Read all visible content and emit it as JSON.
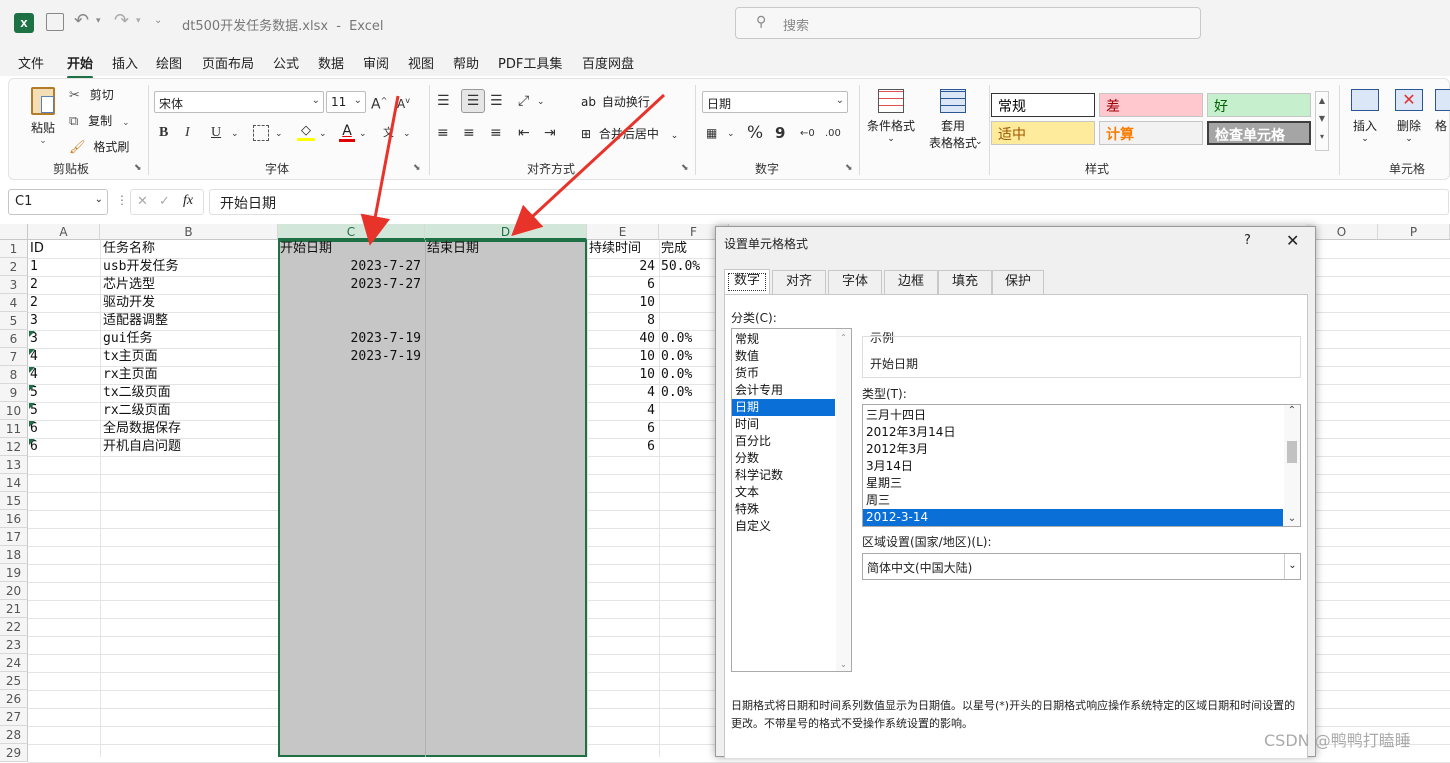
{
  "titlebar": {
    "filename": "dt500开发任务数据.xlsx",
    "separator": "-",
    "app": "Excel",
    "search_placeholder": "搜索"
  },
  "menu_tabs": [
    "文件",
    "开始",
    "插入",
    "绘图",
    "页面布局",
    "公式",
    "数据",
    "审阅",
    "视图",
    "帮助",
    "PDF工具集",
    "百度网盘"
  ],
  "active_tab": "开始",
  "ribbon": {
    "clipboard": {
      "paste": "粘贴",
      "cut": "剪切",
      "copy": "复制",
      "format_painter": "格式刷",
      "group": "剪贴板"
    },
    "font": {
      "name": "宋体",
      "size": "11",
      "bold": "B",
      "italic": "I",
      "underline": "U",
      "group": "字体",
      "fill_color": "#ffff00",
      "font_color": "#e00000"
    },
    "align": {
      "wrap": "自动换行",
      "merge": "合并后居中",
      "group": "对齐方式"
    },
    "number": {
      "format": "日期",
      "percent": "%",
      "comma": "9",
      "group": "数字"
    },
    "cond": {
      "cond_format": "条件格式",
      "table_format": "套用",
      "table_format2": "表格格式",
      "group": "样式"
    },
    "styles": [
      {
        "label": "常规",
        "bg": "#ffffff",
        "color": "#000000"
      },
      {
        "label": "差",
        "bg": "#ffc7ce",
        "color": "#9c0006"
      },
      {
        "label": "好",
        "bg": "#c6efce",
        "color": "#006100"
      },
      {
        "label": "适中",
        "bg": "#ffeb9c",
        "color": "#9c5700"
      },
      {
        "label": "计算",
        "bg": "#f2f2f2",
        "color": "#fa7d00"
      },
      {
        "label": "检查单元格",
        "bg": "#a5a5a5",
        "color": "#ffffff"
      }
    ],
    "cells": {
      "insert": "插入",
      "delete": "删除",
      "format": "格",
      "group": "单元格"
    }
  },
  "formula_bar": {
    "name_box": "C1",
    "fx": "fx",
    "content": "开始日期"
  },
  "columns": [
    "A",
    "B",
    "C",
    "D",
    "E",
    "F",
    "O",
    "P"
  ],
  "rows": [
    {
      "n": "1",
      "a": "ID",
      "b": "任务名称",
      "c": "开始日期",
      "d": "结束日期",
      "e": "持续时间",
      "f": "完成"
    },
    {
      "n": "2",
      "a": "1",
      "b": "usb开发任务",
      "c": "2023-7-27",
      "d": "",
      "e": "24",
      "f": "50.0%"
    },
    {
      "n": "3",
      "a": "2",
      "b": "芯片选型",
      "c": "2023-7-27",
      "d": "",
      "e": "6",
      "f": ""
    },
    {
      "n": "4",
      "a": "2",
      "b": "驱动开发",
      "c": "",
      "d": "",
      "e": "10",
      "f": ""
    },
    {
      "n": "5",
      "a": "3",
      "b": "适配器调整",
      "c": "",
      "d": "",
      "e": "8",
      "f": ""
    },
    {
      "n": "6",
      "a": "3",
      "b": "gui任务",
      "c": "2023-7-19",
      "d": "",
      "e": "40",
      "f": "0.0%"
    },
    {
      "n": "7",
      "a": "4",
      "b": "tx主页面",
      "c": "2023-7-19",
      "d": "",
      "e": "10",
      "f": "0.0%"
    },
    {
      "n": "8",
      "a": "4",
      "b": "rx主页面",
      "c": "",
      "d": "",
      "e": "10",
      "f": "0.0%"
    },
    {
      "n": "9",
      "a": "5",
      "b": "tx二级页面",
      "c": "",
      "d": "",
      "e": "4",
      "f": "0.0%"
    },
    {
      "n": "10",
      "a": "5",
      "b": "rx二级页面",
      "c": "",
      "d": "",
      "e": "4",
      "f": ""
    },
    {
      "n": "11",
      "a": "6",
      "b": "全局数据保存",
      "c": "",
      "d": "",
      "e": "6",
      "f": ""
    },
    {
      "n": "12",
      "a": "6",
      "b": "开机自启问题",
      "c": "",
      "d": "",
      "e": "6",
      "f": ""
    },
    {
      "n": "13"
    },
    {
      "n": "14"
    },
    {
      "n": "15"
    },
    {
      "n": "16"
    },
    {
      "n": "17"
    },
    {
      "n": "18"
    },
    {
      "n": "19"
    },
    {
      "n": "20"
    },
    {
      "n": "21"
    },
    {
      "n": "22"
    },
    {
      "n": "23"
    },
    {
      "n": "24"
    },
    {
      "n": "25"
    },
    {
      "n": "26"
    },
    {
      "n": "27"
    },
    {
      "n": "28"
    },
    {
      "n": "29"
    }
  ],
  "dialog": {
    "title": "设置单元格格式",
    "help": "?",
    "tabs": [
      "数字",
      "对齐",
      "字体",
      "边框",
      "填充",
      "保护"
    ],
    "category_label": "分类(C):",
    "categories": [
      "常规",
      "数值",
      "货币",
      "会计专用",
      "日期",
      "时间",
      "百分比",
      "分数",
      "科学记数",
      "文本",
      "特殊",
      "自定义"
    ],
    "selected_category": "日期",
    "sample_label": "示例",
    "sample_value": "开始日期",
    "type_label": "类型(T):",
    "types": [
      "三月十四日",
      "2012年3月14日",
      "2012年3月",
      "3月14日",
      "星期三",
      "周三",
      "2012-3-14"
    ],
    "selected_type": "2012-3-14",
    "locale_label": "区域设置(国家/地区)(L):",
    "locale_value": "简体中文(中国大陆)",
    "description": "日期格式将日期和时间系列数值显示为日期值。以星号(*)开头的日期格式响应操作系统特定的区域日期和时间设置的更改。不带星号的格式不受操作系统设置的影响。"
  },
  "watermark": "CSDN @鸭鸭打瞌睡",
  "colors": {
    "accent": "#1e7145",
    "selection": "#c6c6c6",
    "arrow": "#e8332a",
    "list_select": "#0a6fd6"
  }
}
